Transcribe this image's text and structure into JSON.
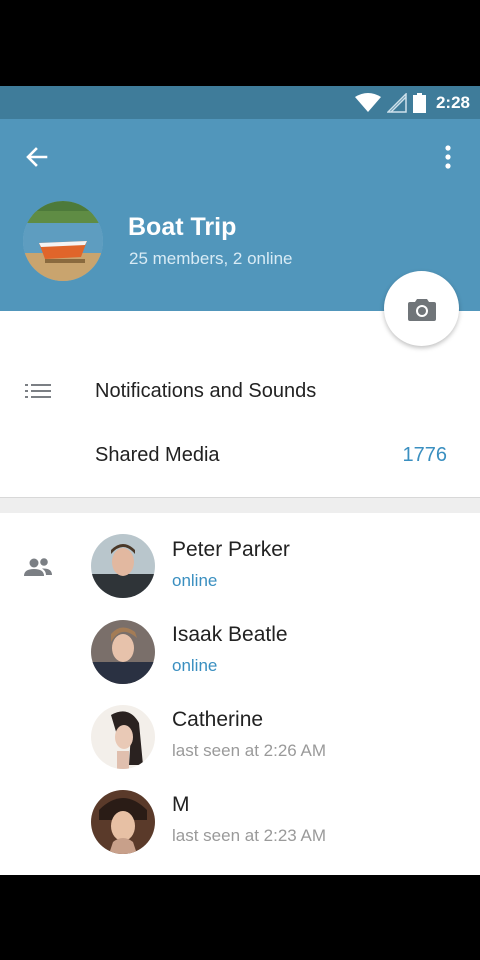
{
  "status_bar": {
    "time": "2:28"
  },
  "header": {
    "group_name": "Boat Trip",
    "subtitle": "25 members, 2 online",
    "back_icon": "arrow-left-icon",
    "menu_icon": "more-vertical-icon",
    "camera_icon": "camera-icon"
  },
  "settings": {
    "notifications_label": "Notifications and Sounds",
    "shared_media_label": "Shared Media",
    "shared_media_count": "1776"
  },
  "members": [
    {
      "name": "Peter Parker",
      "status": "online",
      "online": true
    },
    {
      "name": "Isaak Beatle",
      "status": "online",
      "online": true
    },
    {
      "name": "Catherine",
      "status": "last seen at 2:26 AM",
      "online": false
    },
    {
      "name": "M",
      "status": "last seen at 2:23 AM",
      "online": false
    }
  ],
  "colors": {
    "header": "#5196bb",
    "status_bar": "#3f7c9a",
    "accent": "#3a8fc0"
  }
}
